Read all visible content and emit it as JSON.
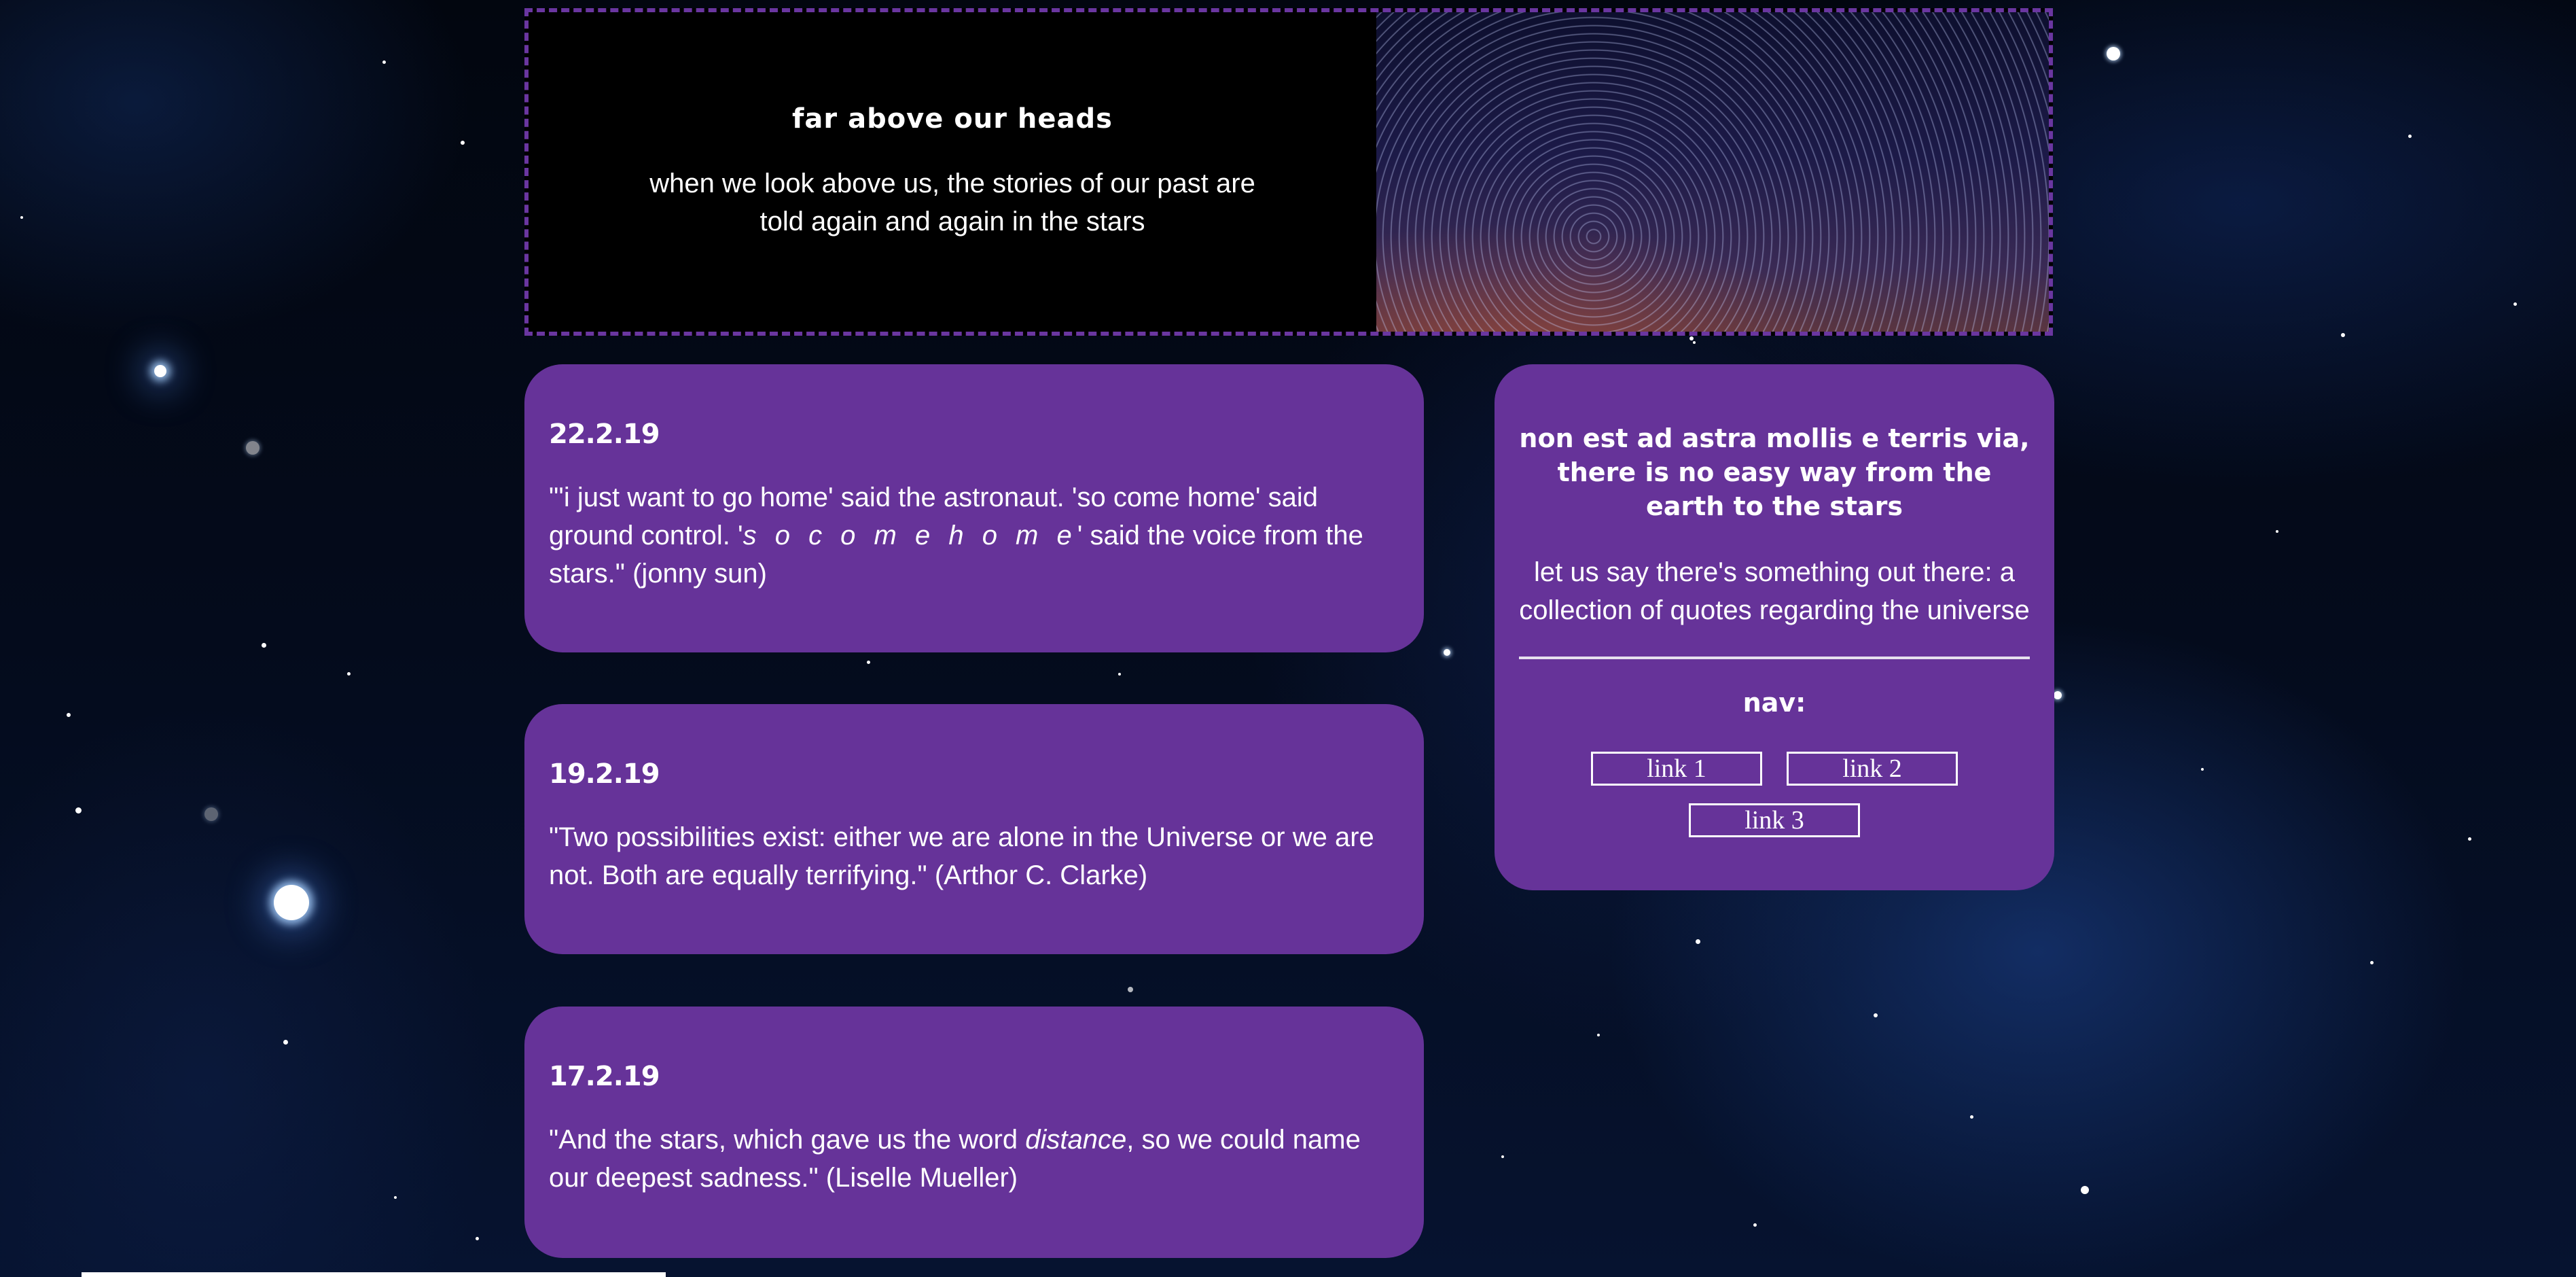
{
  "header": {
    "title": "far above our heads",
    "subtitle": "when we look above us, the stories of our past are told again and again in the stars"
  },
  "posts": [
    {
      "date": "22.2.19",
      "quote_a": "\"'i just want to go home' said the astronaut. 'so come home' said ground control. '",
      "quote_em": "s o c o m e h o m e",
      "quote_b": "' said the voice from the stars.\" (jonny sun)"
    },
    {
      "date": "19.2.19",
      "quote_a": "\"Two possibilities exist: either we are alone in the Universe or we are not. Both are equally terrifying.\" (Arthor C. Clarke)"
    },
    {
      "date": "17.2.19",
      "quote_a": "\"And the stars, which gave us the word ",
      "quote_em": "distance",
      "quote_b": ", so we could name our deepest sadness.\" (Liselle Mueller)"
    }
  ],
  "sidebar": {
    "motto": "non est ad astra mollis e terris via, there is no easy way from the earth to the stars",
    "description": "let us say there's something out there: a collection of quotes regarding the universe",
    "nav_title": "nav:",
    "links": [
      {
        "label": "link 1"
      },
      {
        "label": "link 2"
      },
      {
        "label": "link 3"
      }
    ]
  },
  "colors": {
    "card": "#663399",
    "border": "#6a36a0",
    "background": "#040b1c"
  }
}
